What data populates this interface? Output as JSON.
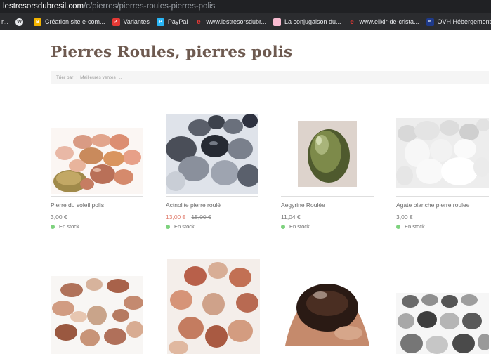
{
  "browser": {
    "url_host": "lestresorsdubresil.com",
    "url_path": "/c/pierres/pierres-roules-pierres-polis",
    "bookmarks": [
      {
        "label": "r...",
        "icon": "folder-icon",
        "color": "#c9a227"
      },
      {
        "label": "",
        "icon": "wordpress-icon",
        "color": "#e8eaed"
      },
      {
        "label": "Création site e-com...",
        "icon": "bookmark-icon",
        "color": "#f4b400"
      },
      {
        "label": "Variantes",
        "icon": "red-square-icon",
        "color": "#e53935"
      },
      {
        "label": "PayPal",
        "icon": "paypal-icon",
        "color": "#29b6f6"
      },
      {
        "label": "www.lestresorsdubr...",
        "icon": "e-icon",
        "color": "#e53935"
      },
      {
        "label": "La conjugaison du...",
        "icon": "pink-square-icon",
        "color": "#f8bbd0"
      },
      {
        "label": "www.elixir-de-crista...",
        "icon": "e-icon",
        "color": "#e53935"
      },
      {
        "label": "OVH Hébergement...",
        "icon": "ovh-icon",
        "color": "#1e3a8a"
      }
    ]
  },
  "page": {
    "title": "Pierres Roules, pierres polis",
    "sort_label": "Trier par",
    "sort_value": "Meilleures ventes",
    "sort_sep": ":"
  },
  "products": [
    {
      "name": "Pierre du soleil polis",
      "price": "3,00 €",
      "old_price": "",
      "stock": "En stock"
    },
    {
      "name": "Actnolite pierre roulé",
      "price": "13,00 €",
      "old_price": "15,00 €",
      "stock": "En stock"
    },
    {
      "name": "Aegyrine Roulée",
      "price": "11,04 €",
      "old_price": "",
      "stock": "En stock"
    },
    {
      "name": "Agate blanche pierre roulee",
      "price": "3,00 €",
      "old_price": "",
      "stock": "En stock"
    },
    {
      "name": "",
      "price": "",
      "old_price": "",
      "stock": ""
    },
    {
      "name": "",
      "price": "",
      "old_price": "",
      "stock": ""
    },
    {
      "name": "",
      "price": "",
      "old_price": "",
      "stock": ""
    },
    {
      "name": "",
      "price": "",
      "old_price": "",
      "stock": ""
    }
  ],
  "colors": {
    "title": "#6e5a50",
    "sale_price": "#e07a6a",
    "in_stock_dot": "#7ed27e"
  }
}
